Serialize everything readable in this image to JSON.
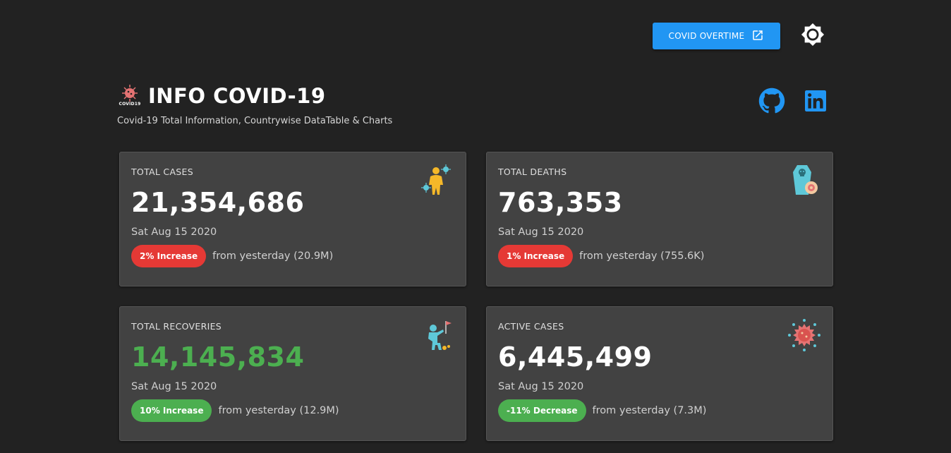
{
  "toolbar": {
    "overtime_label": "COVID OVERTIME",
    "accent": "#2196f3"
  },
  "header": {
    "logo_text": "COVID19",
    "title": "INFO COVID-19",
    "subtitle": "Covid-19 Total Information, Countrywise DataTable & Charts"
  },
  "social": {
    "github_icon": "github-icon",
    "linkedin_icon": "linkedin-icon"
  },
  "cards": [
    {
      "label": "TOTAL CASES",
      "value": "21,354,686",
      "date": "Sat Aug 15 2020",
      "chip": "2% Increase",
      "chip_color": "#e53935",
      "trend": "from yesterday (20.9M)",
      "icon": "person-virus-icon"
    },
    {
      "label": "TOTAL DEATHS",
      "value": "763,353",
      "date": "Sat Aug 15 2020",
      "chip": "1% Increase",
      "chip_color": "#e53935",
      "trend": "from yesterday (755.6K)",
      "icon": "coffin-icon"
    },
    {
      "label": "TOTAL RECOVERIES",
      "value": "14,145,834",
      "date": "Sat Aug 15 2020",
      "chip": "10% Increase",
      "chip_color": "#4caf50",
      "trend": "from yesterday (12.9M)",
      "icon": "person-flag-icon"
    },
    {
      "label": "ACTIVE CASES",
      "value": "6,445,499",
      "date": "Sat Aug 15 2020",
      "chip": "-11% Decrease",
      "chip_color": "#4caf50",
      "trend": "from yesterday (7.3M)",
      "icon": "virus-icon"
    }
  ]
}
